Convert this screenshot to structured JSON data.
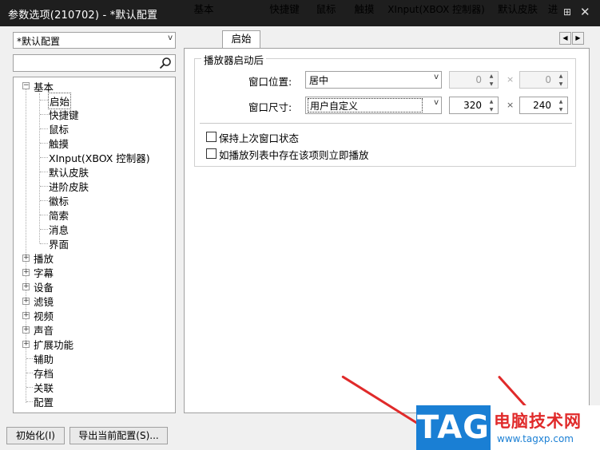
{
  "window": {
    "title": "参数选项(210702) - *默认配置",
    "pin_glyph": "⊞",
    "close_glyph": "✕"
  },
  "left": {
    "profile_value": "*默认配置",
    "search_placeholder": "",
    "tree": {
      "basic": "基本",
      "basic_children": [
        "启始",
        "快捷键",
        "鼠标",
        "触摸",
        "XInput(XBOX 控制器)",
        "默认皮肤",
        "进阶皮肤",
        "徽标",
        "简索",
        "消息",
        "界面"
      ],
      "groups": [
        "播放",
        "字幕",
        "设备",
        "滤镜",
        "视频",
        "声音",
        "扩展功能"
      ],
      "leaves": [
        "辅助",
        "存档",
        "关联",
        "配置"
      ],
      "selected": "启始"
    }
  },
  "tabs": {
    "items": [
      "基本",
      "启始",
      "快捷键",
      "鼠标",
      "触摸",
      "XInput(XBOX 控制器)",
      "默认皮肤",
      "进"
    ],
    "active": "启始",
    "scroll_left": "◀",
    "scroll_right": "▶"
  },
  "startup": {
    "group_title": "播放器启动后",
    "position_label": "窗口位置:",
    "position_value": "居中",
    "pos_x": "0",
    "pos_y": "0",
    "size_label": "窗口尺寸:",
    "size_value": "用户自定义",
    "width": "320",
    "height": "240",
    "times": "×",
    "keep_state_label": "保持上次窗口状态",
    "play_existing_label": "如播放列表中存在该项则立即播放"
  },
  "buttons": {
    "reset": "初始化(I)",
    "export": "导出当前配置(S)..."
  },
  "watermark": {
    "tag": "TAG",
    "site_name": "电脑技术网",
    "url": "www.tagxp.com"
  },
  "colors": {
    "titlebar": "#1e1e1e",
    "accent_red": "#e02a2a",
    "tag_blue": "#1a7fd4"
  }
}
